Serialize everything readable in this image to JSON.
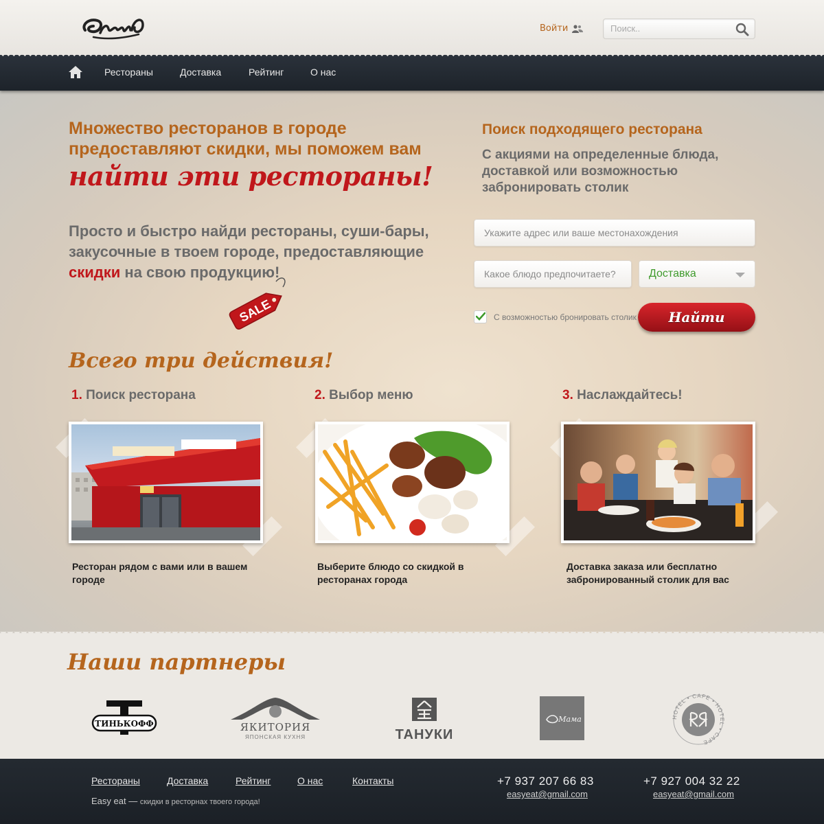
{
  "header": {
    "logo_text": "Byell",
    "login_label": "Войти",
    "search_placeholder": "Поиск.."
  },
  "nav": {
    "items": [
      "Рестораны",
      "Доставка",
      "Рейтинг",
      "О нас"
    ]
  },
  "hero": {
    "lead": "Множество ресторанов в городе предоставляют скидки, мы поможем вам",
    "script": "найти эти рестораны!",
    "sub_before": "Просто и быстро найди рестораны, суши-бары, закусочные в твоем городе, предоставляющие",
    "sub_red": "скидки",
    "sub_after": "на свою продукцию!",
    "sale_tag": "SALE"
  },
  "finder": {
    "title": "Поиск подходящего ресторана",
    "subtitle": "С акциями на определенные блюда, доставкой или возможностью забронировать столик",
    "address_placeholder": "Укажите адрес или ваше местонахождения",
    "dish_placeholder": "Какое блюдо предпочитаете?",
    "select_value": "Доставка",
    "checkbox_label": "С возможностью бронировать столик",
    "checkbox_checked": true,
    "button_label": "Найти"
  },
  "steps": {
    "title": "Всего три действия!",
    "items": [
      {
        "num": "1.",
        "title": "Поиск ресторана",
        "desc": "Ресторан рядом с вами или  в вашем городе"
      },
      {
        "num": "2.",
        "title": "Выбор меню",
        "desc": "Выберите блюдо со скидкой в ресторанах города"
      },
      {
        "num": "3.",
        "title": "Наслаждайтесь!",
        "desc": "Доставка заказа или бесплатно забронированный столик для вас"
      }
    ]
  },
  "partners": {
    "title": "Наши партнеры",
    "logos": [
      "ТИНЬКОФФ",
      "ЯКИТОРИЯ",
      "ЯПОНСКАЯ КУХНЯ",
      "ТАНУКИ",
      "Мама",
      "HOTEL • CAFE • HOTEL • CAFE"
    ]
  },
  "footer": {
    "links": [
      "Рестораны",
      "Доставка",
      "Рейтинг",
      "О нас",
      "Контакты"
    ],
    "brand": "Easy eat —",
    "slogan": "скидки в ресторнах твоего города!",
    "phone1": "+7 937 207 66 83",
    "email1": "easyeat@gmail.com",
    "phone2": "+7 927 004 32 22",
    "email2": "easyeat@gmail.com"
  },
  "colors": {
    "accent_orange": "#b5651d",
    "accent_red": "#c0171b",
    "nav_dark": "#232a31",
    "select_green": "#3e9a2b"
  }
}
